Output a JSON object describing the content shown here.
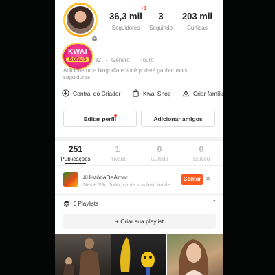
{
  "profile": {
    "stats": [
      {
        "value": "36,3 mil",
        "label": "Seguidores"
      },
      {
        "value": "3",
        "label": "Seguindo"
      },
      {
        "value": "203 mil",
        "label": "Curtidas"
      }
    ],
    "new_followers_badge": "+1",
    "promo": {
      "line1": "KWAI",
      "line2": "BÔNUS"
    },
    "meta": {
      "id_fragment": "32",
      "gender": "Gênero",
      "sign": "Touro"
    },
    "bio_placeholder": "Adicione uma biografia e você poderá ganhar mais seguidores"
  },
  "shortcuts": [
    {
      "label": "Central do Criador",
      "icon": "creator-center-icon"
    },
    {
      "label": "Kwai Shop",
      "icon": "shopping-bag-icon"
    },
    {
      "label": "Criar família",
      "icon": "family-icon"
    }
  ],
  "actions": {
    "edit_profile": "Editar perfil",
    "add_friends": "Adicionar amigos"
  },
  "tabs": [
    {
      "count": "251",
      "label": "Publicações",
      "active": true
    },
    {
      "count": "1",
      "label": "Privado",
      "active": false
    },
    {
      "count": "0",
      "label": "Curtida",
      "active": false
    },
    {
      "count": "0",
      "label": "Salvou",
      "active": false
    }
  ],
  "challenge": {
    "title": "#HistóriaDeAmor",
    "subtitle": "Neste São João, conte sua história de amor...",
    "button": "Contar",
    "close": "×"
  },
  "playlists": {
    "label": "0 Playlists",
    "create_label": "Criar sua playlist",
    "chevron": "⌃",
    "plus": "+"
  },
  "colors": {
    "accent": "#ff5a1f",
    "notification": "#ff3b30",
    "promo_pink": "#e61c7a"
  }
}
